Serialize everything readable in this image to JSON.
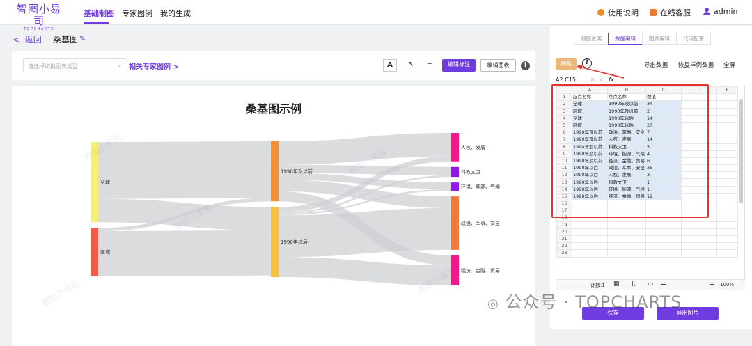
{
  "header": {
    "logo_cn": "智图小易司",
    "logo_en": "TOPCHARTS",
    "nav": [
      "基础制图",
      "专家图例",
      "我的生成"
    ],
    "help": "使用说明",
    "service": "在线客服",
    "user": "admin",
    "colors": {
      "accent": "#6f3ce0",
      "help": "#f08a24",
      "service": "#f07a2a"
    }
  },
  "page": {
    "back": "返回",
    "chart_name": "桑基图",
    "select_placeholder": "请选择切换图表类型",
    "related": "相关专家图例",
    "edit_label": "编辑标注",
    "edit_chart": "编辑图表",
    "watermark": "智图小易司"
  },
  "chart_data": {
    "type": "sankey",
    "title": "桑基图示例",
    "nodes": [
      "全球",
      "区域",
      "1990年及以前",
      "1990年以后",
      "人权、发展",
      "科教文卫",
      "环境、能源、气候",
      "政治、军事、安全",
      "经济、金融、贸易"
    ],
    "node_colors": {
      "全球": "#f5f07a",
      "区域": "#f25a4a",
      "1990年及以前": "#f3913a",
      "1990年以后": "#f6c244",
      "人权、发展": "#f0188c",
      "科教文卫": "#8f1be8",
      "环境、能源、气候": "#8f1be8",
      "政治、军事、安全": "#f07a3c",
      "经济、金融、贸易": "#f0188c"
    },
    "links": [
      {
        "source": "全球",
        "target": "1990年及以前",
        "value": 34
      },
      {
        "source": "区域",
        "target": "1990年及以前",
        "value": 2
      },
      {
        "source": "全球",
        "target": "1990年以后",
        "value": 14
      },
      {
        "source": "区域",
        "target": "1990年以后",
        "value": 27
      },
      {
        "source": "1990年及以前",
        "target": "政治、军事、安全",
        "value": 7
      },
      {
        "source": "1990年及以前",
        "target": "人权、发展",
        "value": 14
      },
      {
        "source": "1990年及以前",
        "target": "科教文卫",
        "value": 5
      },
      {
        "source": "1990年及以前",
        "target": "环境、能源、气候",
        "value": 4
      },
      {
        "source": "1990年及以前",
        "target": "经济、金融、贸易",
        "value": 6
      },
      {
        "source": "1990年以后",
        "target": "政治、军事、安全",
        "value": 25
      },
      {
        "source": "1990年以后",
        "target": "人权、发展",
        "value": 3
      },
      {
        "source": "1990年以后",
        "target": "科教文卫",
        "value": 1
      },
      {
        "source": "1990年以后",
        "target": "环境、能源、气候",
        "value": 1
      },
      {
        "source": "1990年以后",
        "target": "经济、金融、贸易",
        "value": 12
      }
    ],
    "link_color": "#cdd0d3"
  },
  "panel": {
    "tabs": [
      "制图说明",
      "数据编辑",
      "图表编辑",
      "代码配置"
    ],
    "refresh": "刷新",
    "export_data": "导出数据",
    "restore": "恢复样例数据",
    "fullscreen": "全屏",
    "cell_ref": "A2:C15",
    "fx": "fx",
    "columns": [
      "A",
      "B",
      "C",
      "D",
      "E"
    ],
    "headers": [
      "起点名称",
      "终点名称",
      "数值"
    ],
    "rows": [
      [
        "全球",
        "1990年及以前",
        "34"
      ],
      [
        "区域",
        "1990年及以前",
        "2"
      ],
      [
        "全球",
        "1990年以后",
        "14"
      ],
      [
        "区域",
        "1990年以后",
        "27"
      ],
      [
        "1990年及以前",
        "政治、军事、安全",
        "7"
      ],
      [
        "1990年及以前",
        "人权、发展",
        "14"
      ],
      [
        "1990年及以前",
        "科教文卫",
        "5"
      ],
      [
        "1990年及以前",
        "环境、能源、气候",
        "4"
      ],
      [
        "1990年及以前",
        "经济、金融、贸易",
        "6"
      ],
      [
        "1990年以后",
        "政治、军事、安全",
        "25"
      ],
      [
        "1990年以后",
        "人权、发展",
        "3"
      ],
      [
        "1990年以后",
        "科教文卫",
        "1"
      ],
      [
        "1990年以后",
        "环境、能源、气候",
        "1"
      ],
      [
        "1990年以后",
        "经济、金融、贸易",
        "12"
      ]
    ],
    "row_count": 23,
    "sheet_count": "计数:1",
    "zoom": "100%",
    "save": "保存",
    "export_image": "导出图片",
    "brand_watermark": "公众号 · TOPCHARTS"
  }
}
